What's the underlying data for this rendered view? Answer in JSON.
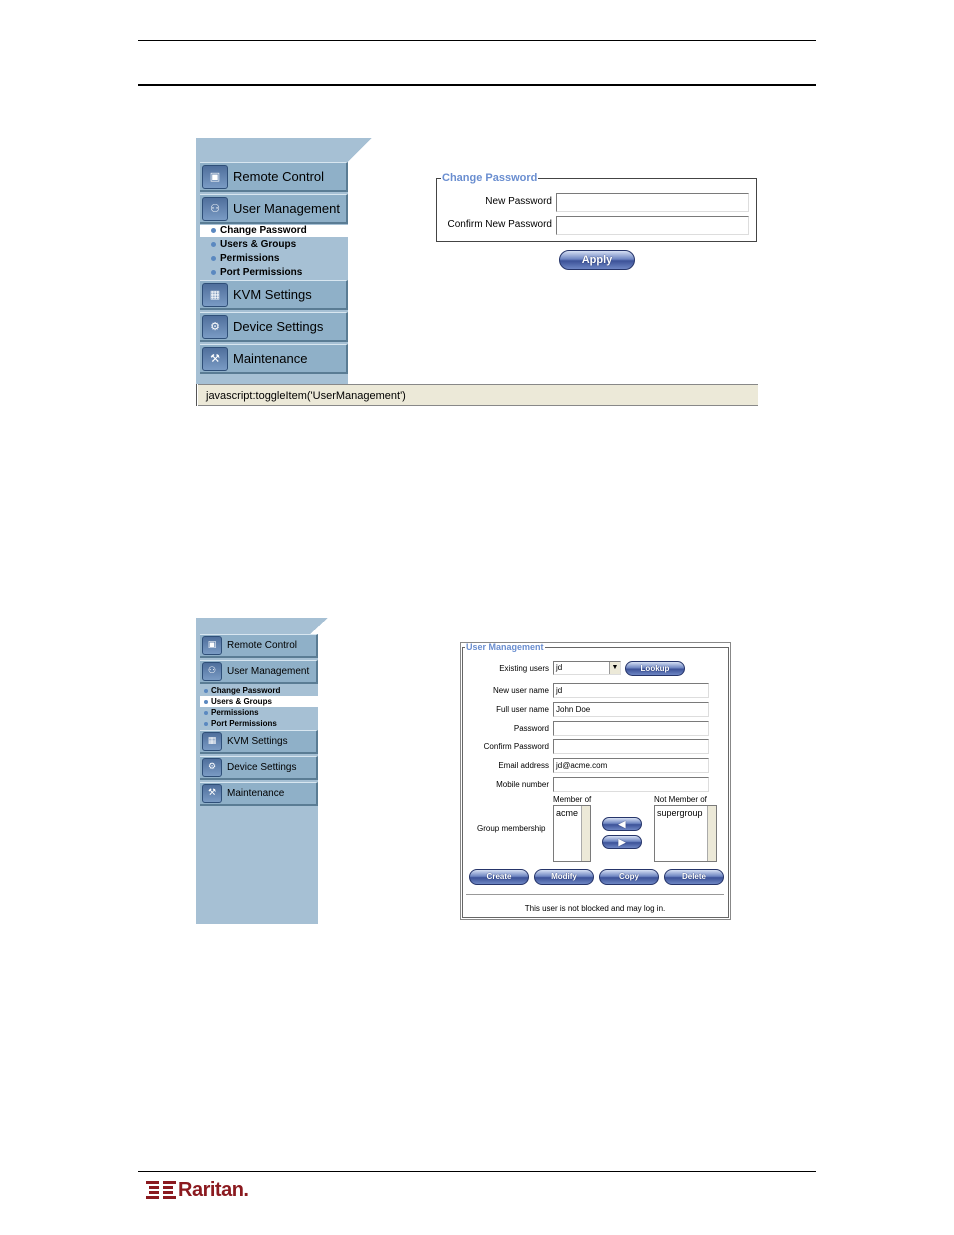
{
  "screenshot1": {
    "menu": [
      {
        "label": "Remote Control",
        "icon": "monitor-icon"
      },
      {
        "label": "User Management",
        "icon": "users-icon"
      },
      {
        "label": "KVM Settings",
        "icon": "keyboard-icon"
      },
      {
        "label": "Device Settings",
        "icon": "gears-icon"
      },
      {
        "label": "Maintenance",
        "icon": "wrench-icon"
      }
    ],
    "submenu": [
      "Change Password",
      "Users & Groups",
      "Permissions",
      "Port Permissions"
    ],
    "form": {
      "legend": "Change Password",
      "new_password_label": "New Password",
      "confirm_password_label": "Confirm New Password",
      "apply_label": "Apply"
    },
    "status_bar": "javascript:toggleItem('UserManagement')"
  },
  "screenshot2": {
    "menu": [
      {
        "label": "Remote Control",
        "icon": "monitor-icon"
      },
      {
        "label": "User Management",
        "icon": "users-icon"
      },
      {
        "label": "KVM Settings",
        "icon": "keyboard-icon"
      },
      {
        "label": "Device Settings",
        "icon": "gears-icon"
      },
      {
        "label": "Maintenance",
        "icon": "wrench-icon"
      }
    ],
    "submenu": [
      "Change Password",
      "Users & Groups",
      "Permissions",
      "Port Permissions"
    ],
    "form": {
      "legend": "User Management",
      "existing_users_label": "Existing users",
      "existing_users_value": "jd",
      "lookup_label": "Lookup",
      "new_user_name_label": "New user name",
      "new_user_name_value": "jd",
      "full_user_name_label": "Full user name",
      "full_user_name_value": "John Doe",
      "password_label": "Password",
      "confirm_password_label": "Confirm Password",
      "email_label": "Email address",
      "email_value": "jd@acme.com",
      "mobile_label": "Mobile number",
      "member_of_label": "Member of",
      "not_member_of_label": "Not Member of",
      "group_membership_label": "Group membership",
      "member_of_items": [
        "acme"
      ],
      "not_member_of_items": [
        "supergroup"
      ],
      "create_label": "Create",
      "modify_label": "Modify",
      "copy_label": "Copy",
      "delete_label": "Delete",
      "status_note": "This user is not blocked and may log in."
    }
  },
  "footer": {
    "logo_text": "Raritan."
  }
}
